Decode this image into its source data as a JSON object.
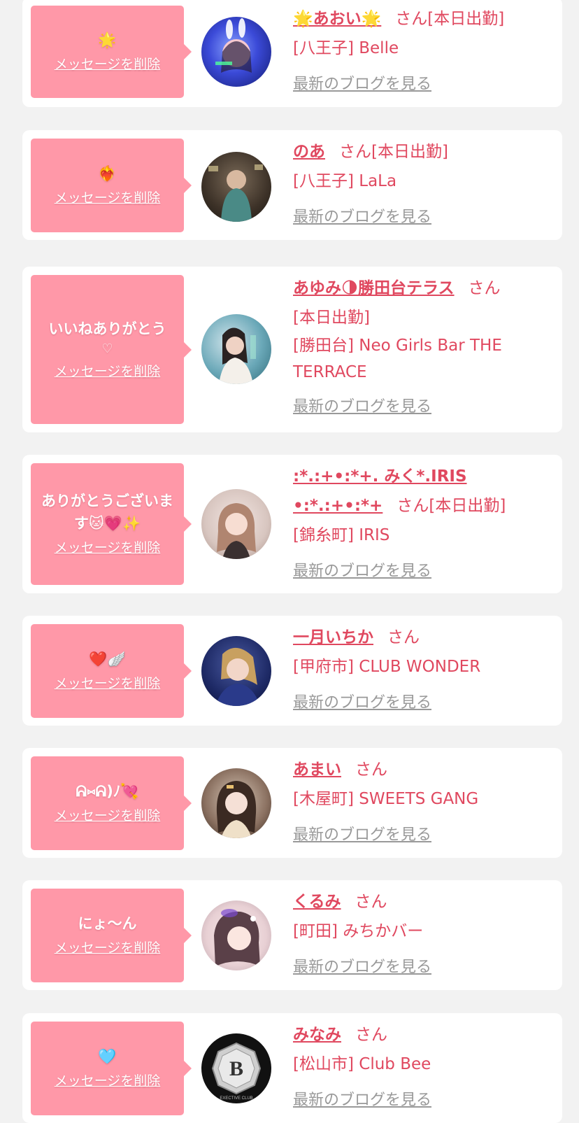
{
  "delete_label": "メッセージを削除",
  "san_label": "さん",
  "blog_label": "最新のブログを見る",
  "items": [
    {
      "message": "🌟",
      "name": "🌟あおい🌟",
      "status": "[本日出勤]",
      "shop": "[八王子] Belle"
    },
    {
      "message": "❤️‍🔥",
      "name": "のあ",
      "status": "[本日出勤]",
      "shop": "[八王子] LaLa"
    },
    {
      "message": "いいねありがとう",
      "message_extra": "♡",
      "name": "あゆみ🌗勝田台テラス",
      "status": "[本日出勤]",
      "shop": "[勝田台] Neo Girls Bar THE TERRACE"
    },
    {
      "message": "ありがとうございます🐱💗✨",
      "name": ":*.:+•:*+. みく*.IRIS •:*.:+•:*+",
      "status": "[本日出勤]",
      "shop": "[錦糸町] IRIS"
    },
    {
      "message": "❤️🪽",
      "name": "一月いちか",
      "status": "",
      "shop": "[甲府市] CLUB WONDER"
    },
    {
      "message": "ᕱ⑅ᕱ)ﾉ💘",
      "name": "あまい",
      "status": "",
      "shop": "[木屋町] SWEETS GANG"
    },
    {
      "message": "にょ〜ん",
      "name": "くるみ",
      "status": "",
      "shop": "[町田] みちかバー"
    },
    {
      "message": "🩵",
      "name": "みなみ",
      "status": "",
      "shop": "[松山市] Club Bee"
    }
  ],
  "logo_text": {
    "letter": "B",
    "sub": "EXECTIVE CLUB"
  }
}
